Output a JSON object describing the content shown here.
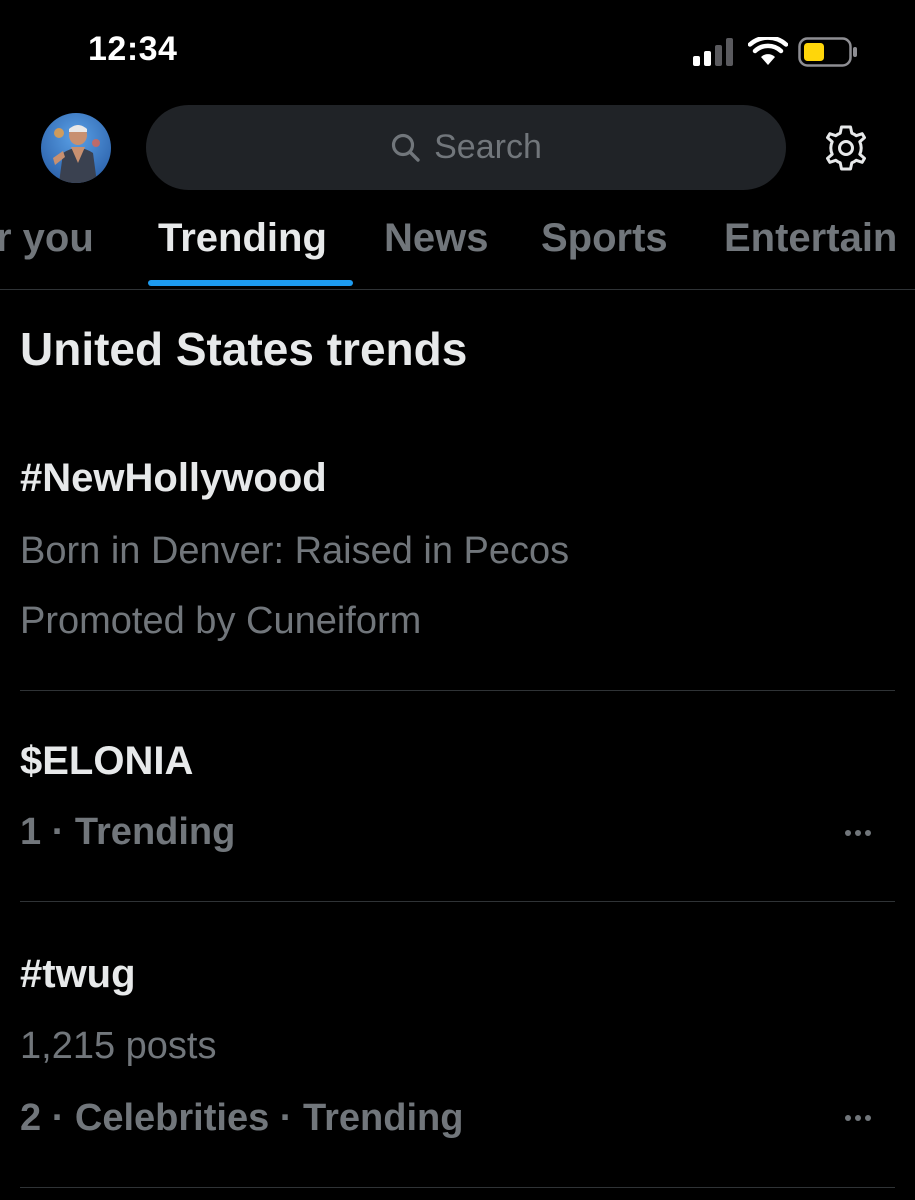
{
  "status_bar": {
    "time": "12:34",
    "icons": [
      "signal-icon",
      "wifi-icon",
      "battery-icon"
    ],
    "battery_color": "#ffd60a"
  },
  "header": {
    "search_placeholder": "Search",
    "icons": [
      "avatar",
      "search-icon",
      "settings-icon"
    ]
  },
  "tabs": [
    {
      "label": "r you",
      "active": false
    },
    {
      "label": "Trending",
      "active": true
    },
    {
      "label": "News",
      "active": false
    },
    {
      "label": "Sports",
      "active": false
    },
    {
      "label": "Entertain",
      "active": false
    }
  ],
  "section_title": "United States trends",
  "trends": [
    {
      "name": "#NewHollywood",
      "description": "Born in Denver: Raised in Pecos",
      "promoted": "Promoted by Cuneiform"
    },
    {
      "name": "$ELONIA",
      "meta": "1 · Trending"
    },
    {
      "name": "#twug",
      "posts": "1,215 posts",
      "meta": "2 · Celebrities · Trending"
    }
  ],
  "colors": {
    "background": "#000000",
    "primary_text": "#e7e9ea",
    "secondary_text": "#71767b",
    "accent": "#1d9bf0",
    "search_bg": "#202327",
    "divider": "#2f3336"
  }
}
